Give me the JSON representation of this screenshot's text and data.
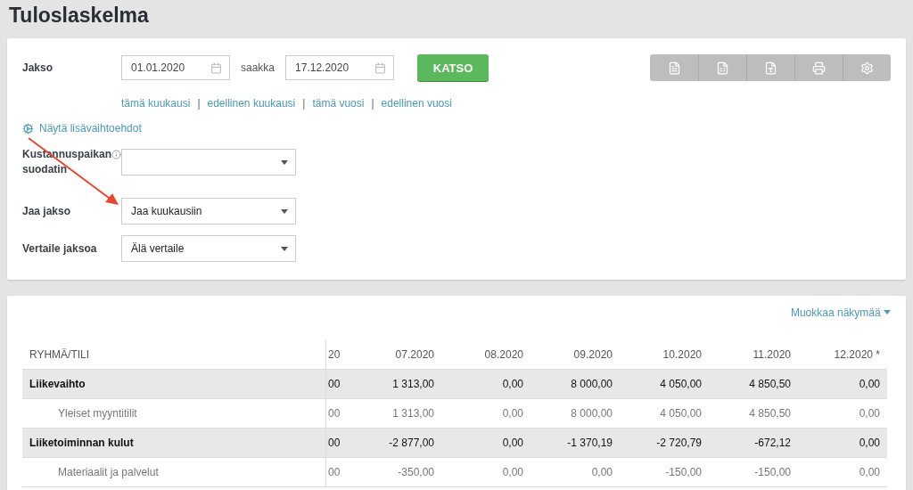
{
  "title": "Tuloslaskelma",
  "period": {
    "label": "Jakso",
    "from": "01.01.2020",
    "separator": "saakka",
    "to": "17.12.2020"
  },
  "view_button": "KATSO",
  "quick_links": [
    {
      "kind": "link",
      "text": "tämä kuukausi"
    },
    {
      "kind": "separator",
      "text": "|"
    },
    {
      "kind": "link",
      "text": "edellinen kuukausi"
    },
    {
      "kind": "separator",
      "text": "|"
    },
    {
      "kind": "link",
      "text": "tämä vuosi"
    },
    {
      "kind": "separator",
      "text": "|"
    },
    {
      "kind": "link",
      "text": "edellinen vuosi"
    }
  ],
  "more_options": "Näytä lisävaihtoehdot",
  "selects": [
    {
      "label": "Kustannuspaikan suodatin",
      "info": true
    },
    {
      "label": "Jaa jakso",
      "value": "Jaa kuukausiin",
      "info": false
    },
    {
      "label": "Vertaile jaksoa",
      "value": "Älä vertaile",
      "info": false
    }
  ],
  "edit_view": "Muokkaa näkymää",
  "table": {
    "columns": [
      "RYHMÄ/TILI",
      "20",
      "07.2020",
      "08.2020",
      "09.2020",
      "10.2020",
      "11.2020",
      "12.2020 *"
    ],
    "rows": [
      {
        "kind": "group",
        "cells": [
          "Liikevaihto",
          "00",
          "1 313,00",
          "0,00",
          "8 000,00",
          "4 050,00",
          "4 850,50",
          "0,00"
        ]
      },
      {
        "kind": "account",
        "cells": [
          "Yleiset myyntitilit",
          "00",
          "1 313,00",
          "0,00",
          "8 000,00",
          "4 050,00",
          "4 850,50",
          "0,00"
        ]
      },
      {
        "kind": "group",
        "cells": [
          "Liiketoiminnan kulut",
          "00",
          "-2 877,00",
          "0,00",
          "-1 370,19",
          "-2 720,79",
          "-672,12",
          "0,00"
        ]
      },
      {
        "kind": "account",
        "cells": [
          "Materiaalit ja palvelut",
          "00",
          "-350,00",
          "0,00",
          "0,00",
          "-150,00",
          "-150,00",
          "0,00"
        ]
      }
    ]
  }
}
